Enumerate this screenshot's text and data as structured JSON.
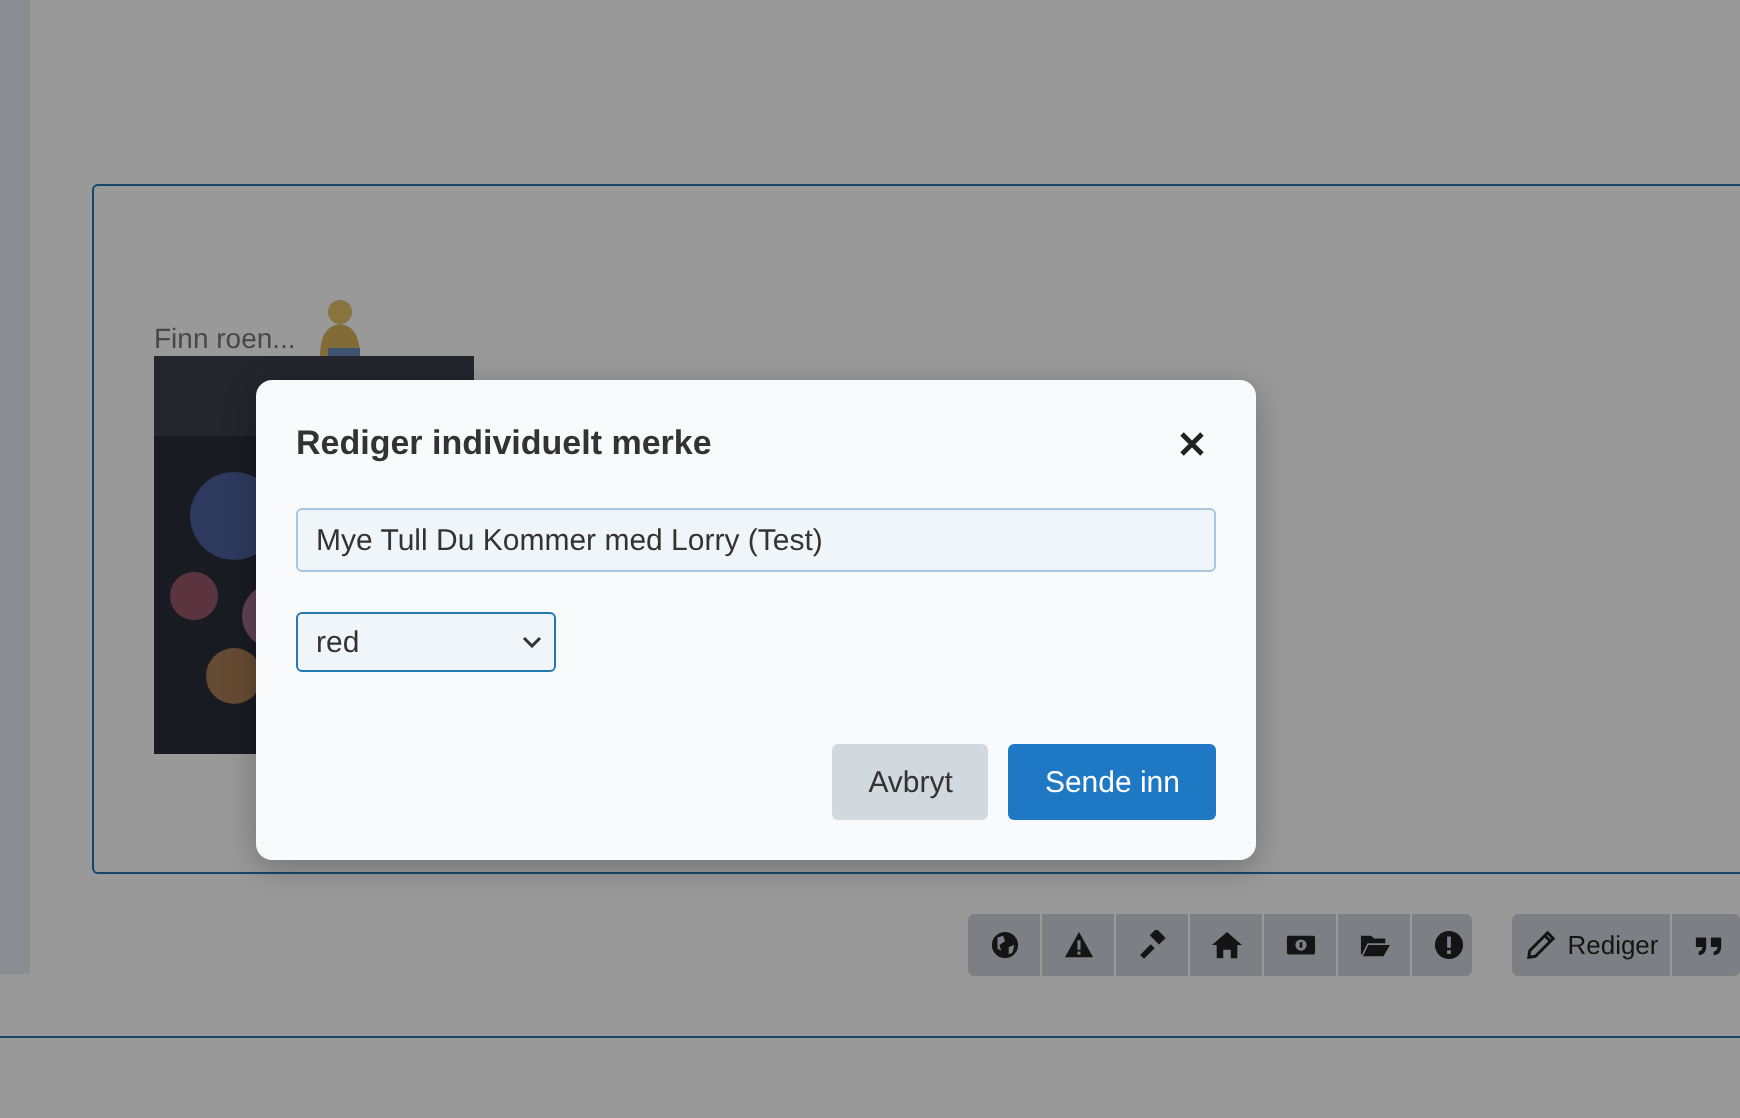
{
  "page": {
    "caption": "Finn roen..."
  },
  "toolbar": {
    "icon_buttons": [
      {
        "kind": "globe"
      },
      {
        "kind": "warning"
      },
      {
        "kind": "gavel"
      },
      {
        "kind": "home"
      },
      {
        "kind": "money"
      },
      {
        "kind": "folder"
      },
      {
        "kind": "alert"
      }
    ],
    "action_buttons": [
      {
        "kind": "edit",
        "label": "Rediger"
      },
      {
        "kind": "quote"
      }
    ]
  },
  "modal": {
    "title": "Rediger individuelt merke",
    "name_field": {
      "value": "Mye Tull Du Kommer med Lorry (Test)"
    },
    "color_select": {
      "value": "red"
    },
    "buttons": [
      {
        "kind": "secondary",
        "label": "Avbryt"
      },
      {
        "kind": "primary",
        "label": "Sende inn"
      }
    ]
  }
}
